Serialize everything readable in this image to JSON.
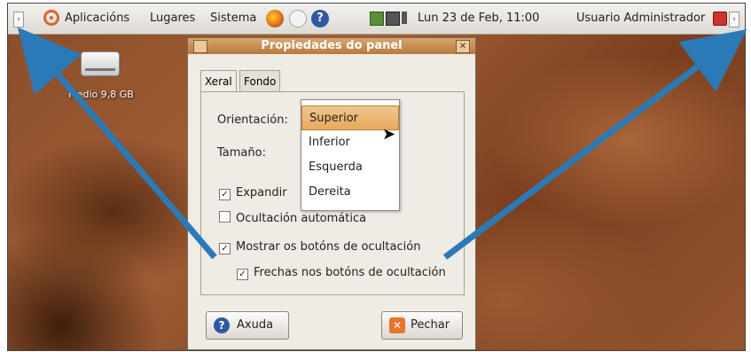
{
  "top_panel": {
    "left_arrow": "‹",
    "right_arrow": "›",
    "menu": [
      "Aplicacións",
      "Lugares",
      "Sistema"
    ],
    "clock": "Lun 23 de Feb, 11:00",
    "user": "Usuario Administrador"
  },
  "desktop": {
    "drive_label": "Medio 9,8 GB"
  },
  "dialog": {
    "title": "Propiedades do panel",
    "close_glyph": "✕",
    "tabs": [
      "Xeral",
      "Fondo"
    ],
    "orientation_label": "Orientación:",
    "size_label": "Tamaño:",
    "expand_label": "Expandir",
    "autohide_label": "Ocultación automática",
    "show_hide_buttons_label": "Mostrar os botóns de ocultación",
    "arrows_on_hide_buttons_label": "Frechas nos botóns de ocultación",
    "expand_checked": true,
    "autohide_checked": false,
    "show_hide_buttons_checked": true,
    "arrows_on_hide_buttons_checked": true,
    "help_button": "Axuda",
    "close_button": "Pechar"
  },
  "dropdown": {
    "options": [
      "Superior",
      "Inferior",
      "Esquerda",
      "Dereita"
    ],
    "selected": "Superior"
  },
  "colors": {
    "annotation_arrow": "#2a7ab8",
    "title_bar": "#c58a4c",
    "selected_item": "#eeb66f"
  }
}
